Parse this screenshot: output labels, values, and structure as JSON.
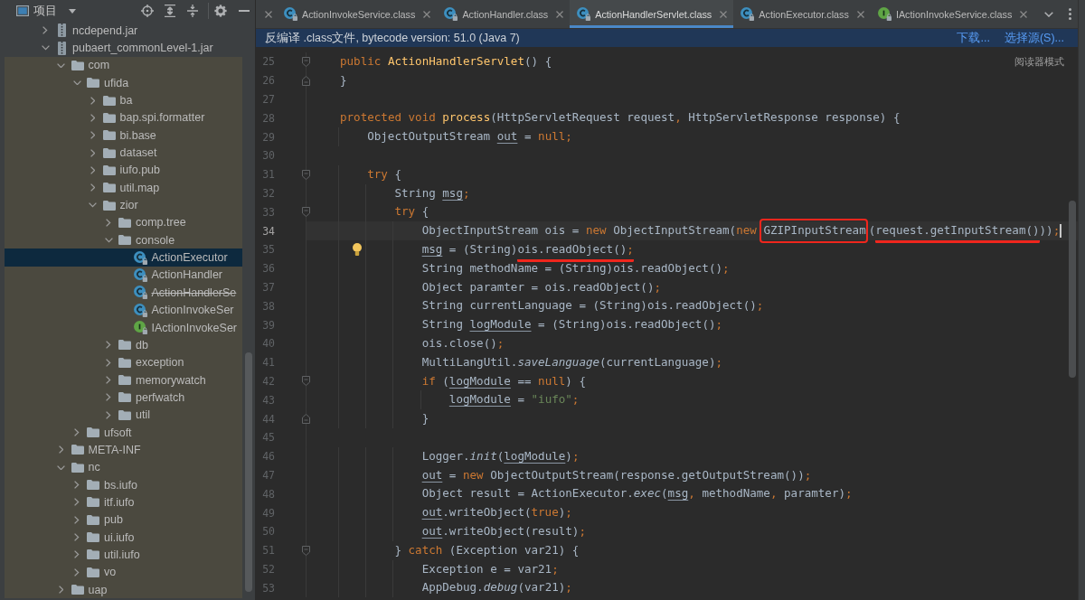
{
  "project_panel": {
    "title": "项目",
    "tree": [
      {
        "label": "ncdepend.jar",
        "kind": "jar",
        "expanded": false,
        "selected": false
      },
      {
        "label": "pubaert_commonLevel-1.jar",
        "kind": "jar",
        "expanded": true,
        "selected": false,
        "children": [
          {
            "label": "com",
            "kind": "folder",
            "expanded": true,
            "selected": false,
            "children": [
              {
                "label": "ufida",
                "kind": "folder",
                "expanded": true,
                "selected": false,
                "children": [
                  {
                    "label": "ba",
                    "kind": "folder",
                    "expanded": false,
                    "selected": false
                  },
                  {
                    "label": "bap.spi.formatter",
                    "kind": "folder",
                    "expanded": false,
                    "selected": false
                  },
                  {
                    "label": "bi.base",
                    "kind": "folder",
                    "expanded": false,
                    "selected": false
                  },
                  {
                    "label": "dataset",
                    "kind": "folder",
                    "expanded": false,
                    "selected": false
                  },
                  {
                    "label": "iufo.pub",
                    "kind": "folder",
                    "expanded": false,
                    "selected": false
                  },
                  {
                    "label": "util.map",
                    "kind": "folder",
                    "expanded": false,
                    "selected": false
                  },
                  {
                    "label": "zior",
                    "kind": "folder",
                    "expanded": true,
                    "selected": false,
                    "children": [
                      {
                        "label": "comp.tree",
                        "kind": "folder",
                        "expanded": false,
                        "selected": false
                      },
                      {
                        "label": "console",
                        "kind": "folder",
                        "expanded": true,
                        "selected": false,
                        "children": [
                          {
                            "label": "ActionExecutor",
                            "kind": "class",
                            "selected": true,
                            "deprecated": false
                          },
                          {
                            "label": "ActionHandler",
                            "kind": "class",
                            "selected": false,
                            "deprecated": false
                          },
                          {
                            "label": "ActionHandlerSe",
                            "kind": "class",
                            "selected": false,
                            "deprecated": true
                          },
                          {
                            "label": "ActionInvokeSer",
                            "kind": "class",
                            "selected": false,
                            "deprecated": false
                          },
                          {
                            "label": "IActionInvokeSer",
                            "kind": "interface",
                            "selected": false,
                            "deprecated": false
                          }
                        ]
                      },
                      {
                        "label": "db",
                        "kind": "folder",
                        "expanded": false,
                        "selected": false
                      },
                      {
                        "label": "exception",
                        "kind": "folder",
                        "expanded": false,
                        "selected": false
                      },
                      {
                        "label": "memorywatch",
                        "kind": "folder",
                        "expanded": false,
                        "selected": false
                      },
                      {
                        "label": "perfwatch",
                        "kind": "folder",
                        "expanded": false,
                        "selected": false
                      },
                      {
                        "label": "util",
                        "kind": "folder",
                        "expanded": false,
                        "selected": false
                      }
                    ]
                  }
                ]
              },
              {
                "label": "ufsoft",
                "kind": "folder",
                "expanded": false,
                "selected": false
              }
            ]
          },
          {
            "label": "META-INF",
            "kind": "folder",
            "expanded": false,
            "selected": false
          },
          {
            "label": "nc",
            "kind": "folder",
            "expanded": true,
            "selected": false,
            "children": [
              {
                "label": "bs.iufo",
                "kind": "folder",
                "expanded": false,
                "selected": false
              },
              {
                "label": "itf.iufo",
                "kind": "folder",
                "expanded": false,
                "selected": false
              },
              {
                "label": "pub",
                "kind": "folder",
                "expanded": false,
                "selected": false
              },
              {
                "label": "ui.iufo",
                "kind": "folder",
                "expanded": false,
                "selected": false
              },
              {
                "label": "util.iufo",
                "kind": "folder",
                "expanded": false,
                "selected": false
              },
              {
                "label": "vo",
                "kind": "folder",
                "expanded": false,
                "selected": false
              }
            ]
          },
          {
            "label": "uap",
            "kind": "folder",
            "expanded": false,
            "selected": false
          }
        ]
      }
    ]
  },
  "tabs": [
    {
      "label": "ActionInvokeService.class",
      "kind": "class",
      "selected": false
    },
    {
      "label": "ActionHandler.class",
      "kind": "class",
      "selected": false
    },
    {
      "label": "ActionHandlerServlet.class",
      "kind": "class",
      "selected": true
    },
    {
      "label": "ActionExecutor.class",
      "kind": "class",
      "selected": false
    },
    {
      "label": "IActionInvokeService.class",
      "kind": "interface",
      "selected": false
    }
  ],
  "banner": {
    "text": "反编译 .class文件, bytecode version: 51.0 (Java 7)",
    "links": [
      "下载...",
      "选择源(S)..."
    ]
  },
  "editor": {
    "reader_mode": "阅读器模式",
    "lines": [
      {
        "number": "25",
        "kind": "fold_start",
        "current": false,
        "tokens": [
          {
            "text": "public ",
            "kind": "keyword"
          },
          {
            "text": "ActionHandlerServlet",
            "kind": "declaration"
          },
          {
            "text": "() {",
            "kind": "plain"
          }
        ]
      },
      {
        "number": "26",
        "kind": "fold_end",
        "current": false,
        "tokens": [
          {
            "text": "}",
            "kind": "plain"
          }
        ]
      },
      {
        "number": "27",
        "kind": "plain",
        "current": false
      },
      {
        "number": "28",
        "kind": "plain",
        "current": false,
        "tokens": [
          {
            "text": "protected void ",
            "kind": "keyword"
          },
          {
            "text": "process",
            "kind": "declaration"
          },
          {
            "text": "(HttpServletRequest request",
            "kind": "plain"
          },
          {
            "text": ",",
            "kind": "punct"
          },
          {
            "text": " HttpServletResponse response) {",
            "kind": "plain"
          }
        ],
        "children": [
          {
            "number": "29",
            "kind": "plain",
            "current": false,
            "tokens": [
              {
                "text": "ObjectOutputStream ",
                "kind": "plain"
              },
              {
                "text": "out",
                "kind": "variable"
              },
              {
                "text": " = ",
                "kind": "plain"
              },
              {
                "text": "null",
                "kind": "keyword"
              },
              {
                "text": ";",
                "kind": "punct"
              }
            ]
          },
          {
            "number": "30",
            "kind": "plain",
            "current": false
          },
          {
            "number": "31",
            "kind": "fold_start",
            "current": false,
            "tokens": [
              {
                "text": "try",
                "kind": "keyword"
              },
              {
                "text": " {",
                "kind": "plain"
              }
            ],
            "children": [
              {
                "number": "32",
                "kind": "plain",
                "current": false,
                "tokens": [
                  {
                    "text": "String ",
                    "kind": "plain"
                  },
                  {
                    "text": "msg",
                    "kind": "variable"
                  },
                  {
                    "text": ";",
                    "kind": "punct"
                  }
                ]
              },
              {
                "number": "33",
                "kind": "fold_start",
                "current": false,
                "tokens": [
                  {
                    "text": "try",
                    "kind": "keyword"
                  },
                  {
                    "text": " {",
                    "kind": "plain"
                  }
                ],
                "children": [
                  {
                    "number": "34",
                    "kind": "plain",
                    "current": true,
                    "tokens": [
                      {
                        "text": "ObjectInputStream ois = ",
                        "kind": "plain"
                      },
                      {
                        "text": "new",
                        "kind": "keyword"
                      },
                      {
                        "text": " ObjectInputStream(",
                        "kind": "plain"
                      },
                      {
                        "text": "new ",
                        "kind": "keyword"
                      },
                      {
                        "kind": "boxed",
                        "tokens": [
                          {
                            "text": "GZIPInputStream",
                            "kind": "plain"
                          }
                        ]
                      },
                      {
                        "text": "(",
                        "kind": "plain"
                      },
                      {
                        "kind": "underlined",
                        "tokens": [
                          {
                            "text": "request.getInputStream()",
                            "kind": "plain"
                          }
                        ]
                      },
                      {
                        "text": "))",
                        "kind": "plain"
                      },
                      {
                        "text": ";",
                        "kind": "punct"
                      }
                    ]
                  },
                  {
                    "number": "35",
                    "kind": "bulb",
                    "current": false,
                    "tokens": [
                      {
                        "text": "msg",
                        "kind": "variable"
                      },
                      {
                        "text": " = (String)",
                        "kind": "plain"
                      },
                      {
                        "kind": "underlined",
                        "tokens": [
                          {
                            "text": "ois.readObject()",
                            "kind": "plain"
                          },
                          {
                            "text": ";",
                            "kind": "punct"
                          }
                        ]
                      }
                    ]
                  },
                  {
                    "number": "36",
                    "kind": "plain",
                    "current": false,
                    "tokens": [
                      {
                        "text": "String methodName = (String)ois.readObject()",
                        "kind": "plain"
                      },
                      {
                        "text": ";",
                        "kind": "punct"
                      }
                    ]
                  },
                  {
                    "number": "37",
                    "kind": "plain",
                    "current": false,
                    "tokens": [
                      {
                        "text": "Object paramter = ois.readObject()",
                        "kind": "plain"
                      },
                      {
                        "text": ";",
                        "kind": "punct"
                      }
                    ]
                  },
                  {
                    "number": "38",
                    "kind": "plain",
                    "current": false,
                    "tokens": [
                      {
                        "text": "String currentLanguage = (String)ois.readObject()",
                        "kind": "plain"
                      },
                      {
                        "text": ";",
                        "kind": "punct"
                      }
                    ]
                  },
                  {
                    "number": "39",
                    "kind": "plain",
                    "current": false,
                    "tokens": [
                      {
                        "text": "String ",
                        "kind": "plain"
                      },
                      {
                        "text": "logModule",
                        "kind": "variable"
                      },
                      {
                        "text": " = (String)ois.readObject()",
                        "kind": "plain"
                      },
                      {
                        "text": ";",
                        "kind": "punct"
                      }
                    ]
                  },
                  {
                    "number": "40",
                    "kind": "plain",
                    "current": false,
                    "tokens": [
                      {
                        "text": "ois.close()",
                        "kind": "plain"
                      },
                      {
                        "text": ";",
                        "kind": "punct"
                      }
                    ]
                  },
                  {
                    "number": "41",
                    "kind": "plain",
                    "current": false,
                    "tokens": [
                      {
                        "text": "MultiLangUtil.",
                        "kind": "plain"
                      },
                      {
                        "text": "saveLanguage",
                        "kind": "static"
                      },
                      {
                        "text": "(currentLanguage)",
                        "kind": "plain"
                      },
                      {
                        "text": ";",
                        "kind": "punct"
                      }
                    ]
                  },
                  {
                    "number": "42",
                    "kind": "fold_start",
                    "current": false,
                    "tokens": [
                      {
                        "text": "if",
                        "kind": "keyword"
                      },
                      {
                        "text": " (",
                        "kind": "plain"
                      },
                      {
                        "text": "logModule",
                        "kind": "variable"
                      },
                      {
                        "text": " == ",
                        "kind": "plain"
                      },
                      {
                        "text": "null",
                        "kind": "keyword"
                      },
                      {
                        "text": ") {",
                        "kind": "plain"
                      }
                    ],
                    "children": [
                      {
                        "number": "43",
                        "kind": "plain",
                        "current": false,
                        "tokens": [
                          {
                            "text": "logModule",
                            "kind": "variable"
                          },
                          {
                            "text": " = ",
                            "kind": "plain"
                          },
                          {
                            "text": "\"iufo\"",
                            "kind": "string"
                          },
                          {
                            "text": ";",
                            "kind": "punct"
                          }
                        ]
                      }
                    ]
                  },
                  {
                    "number": "44",
                    "kind": "fold_end",
                    "current": false,
                    "tokens": [
                      {
                        "text": "}",
                        "kind": "plain"
                      }
                    ]
                  },
                  {
                    "number": "45",
                    "kind": "plain",
                    "current": false
                  },
                  {
                    "number": "46",
                    "kind": "plain",
                    "current": false,
                    "tokens": [
                      {
                        "text": "Logger.",
                        "kind": "plain"
                      },
                      {
                        "text": "init",
                        "kind": "static"
                      },
                      {
                        "text": "(",
                        "kind": "plain"
                      },
                      {
                        "text": "logModule",
                        "kind": "variable"
                      },
                      {
                        "text": ")",
                        "kind": "plain"
                      },
                      {
                        "text": ";",
                        "kind": "punct"
                      }
                    ]
                  },
                  {
                    "number": "47",
                    "kind": "plain",
                    "current": false,
                    "tokens": [
                      {
                        "text": "out",
                        "kind": "variable"
                      },
                      {
                        "text": " = ",
                        "kind": "plain"
                      },
                      {
                        "text": "new",
                        "kind": "keyword"
                      },
                      {
                        "text": " ObjectOutputStream(response.getOutputStream())",
                        "kind": "plain"
                      },
                      {
                        "text": ";",
                        "kind": "punct"
                      }
                    ]
                  },
                  {
                    "number": "48",
                    "kind": "plain",
                    "current": false,
                    "tokens": [
                      {
                        "text": "Object result = ActionExecutor.",
                        "kind": "plain"
                      },
                      {
                        "text": "exec",
                        "kind": "static"
                      },
                      {
                        "text": "(",
                        "kind": "plain"
                      },
                      {
                        "text": "msg",
                        "kind": "variable"
                      },
                      {
                        "text": ",",
                        "kind": "punct"
                      },
                      {
                        "text": " methodName",
                        "kind": "plain"
                      },
                      {
                        "text": ",",
                        "kind": "punct"
                      },
                      {
                        "text": " paramter)",
                        "kind": "plain"
                      },
                      {
                        "text": ";",
                        "kind": "punct"
                      }
                    ]
                  },
                  {
                    "number": "49",
                    "kind": "plain",
                    "current": false,
                    "tokens": [
                      {
                        "text": "out",
                        "kind": "variable"
                      },
                      {
                        "text": ".writeObject(",
                        "kind": "plain"
                      },
                      {
                        "text": "true",
                        "kind": "keyword"
                      },
                      {
                        "text": ")",
                        "kind": "plain"
                      },
                      {
                        "text": ";",
                        "kind": "punct"
                      }
                    ]
                  },
                  {
                    "number": "50",
                    "kind": "plain",
                    "current": false,
                    "tokens": [
                      {
                        "text": "out",
                        "kind": "variable"
                      },
                      {
                        "text": ".writeObject(result)",
                        "kind": "plain"
                      },
                      {
                        "text": ";",
                        "kind": "punct"
                      }
                    ]
                  }
                ]
              },
              {
                "number": "51",
                "kind": "fold_start",
                "current": false,
                "tokens": [
                  {
                    "text": "} ",
                    "kind": "plain"
                  },
                  {
                    "text": "catch",
                    "kind": "keyword"
                  },
                  {
                    "text": " (Exception var21) {",
                    "kind": "plain"
                  }
                ],
                "children": [
                  {
                    "number": "52",
                    "kind": "plain",
                    "current": false,
                    "tokens": [
                      {
                        "text": "Exception e = var21",
                        "kind": "plain"
                      },
                      {
                        "text": ";",
                        "kind": "punct"
                      }
                    ]
                  },
                  {
                    "number": "53",
                    "kind": "plain",
                    "current": false,
                    "tokens": [
                      {
                        "text": "AppDebug.",
                        "kind": "plain"
                      },
                      {
                        "text": "debug",
                        "kind": "static"
                      },
                      {
                        "text": "(var21)",
                        "kind": "plain"
                      },
                      {
                        "text": ";",
                        "kind": "punct"
                      }
                    ]
                  }
                ]
              }
            ]
          }
        ]
      }
    ]
  }
}
